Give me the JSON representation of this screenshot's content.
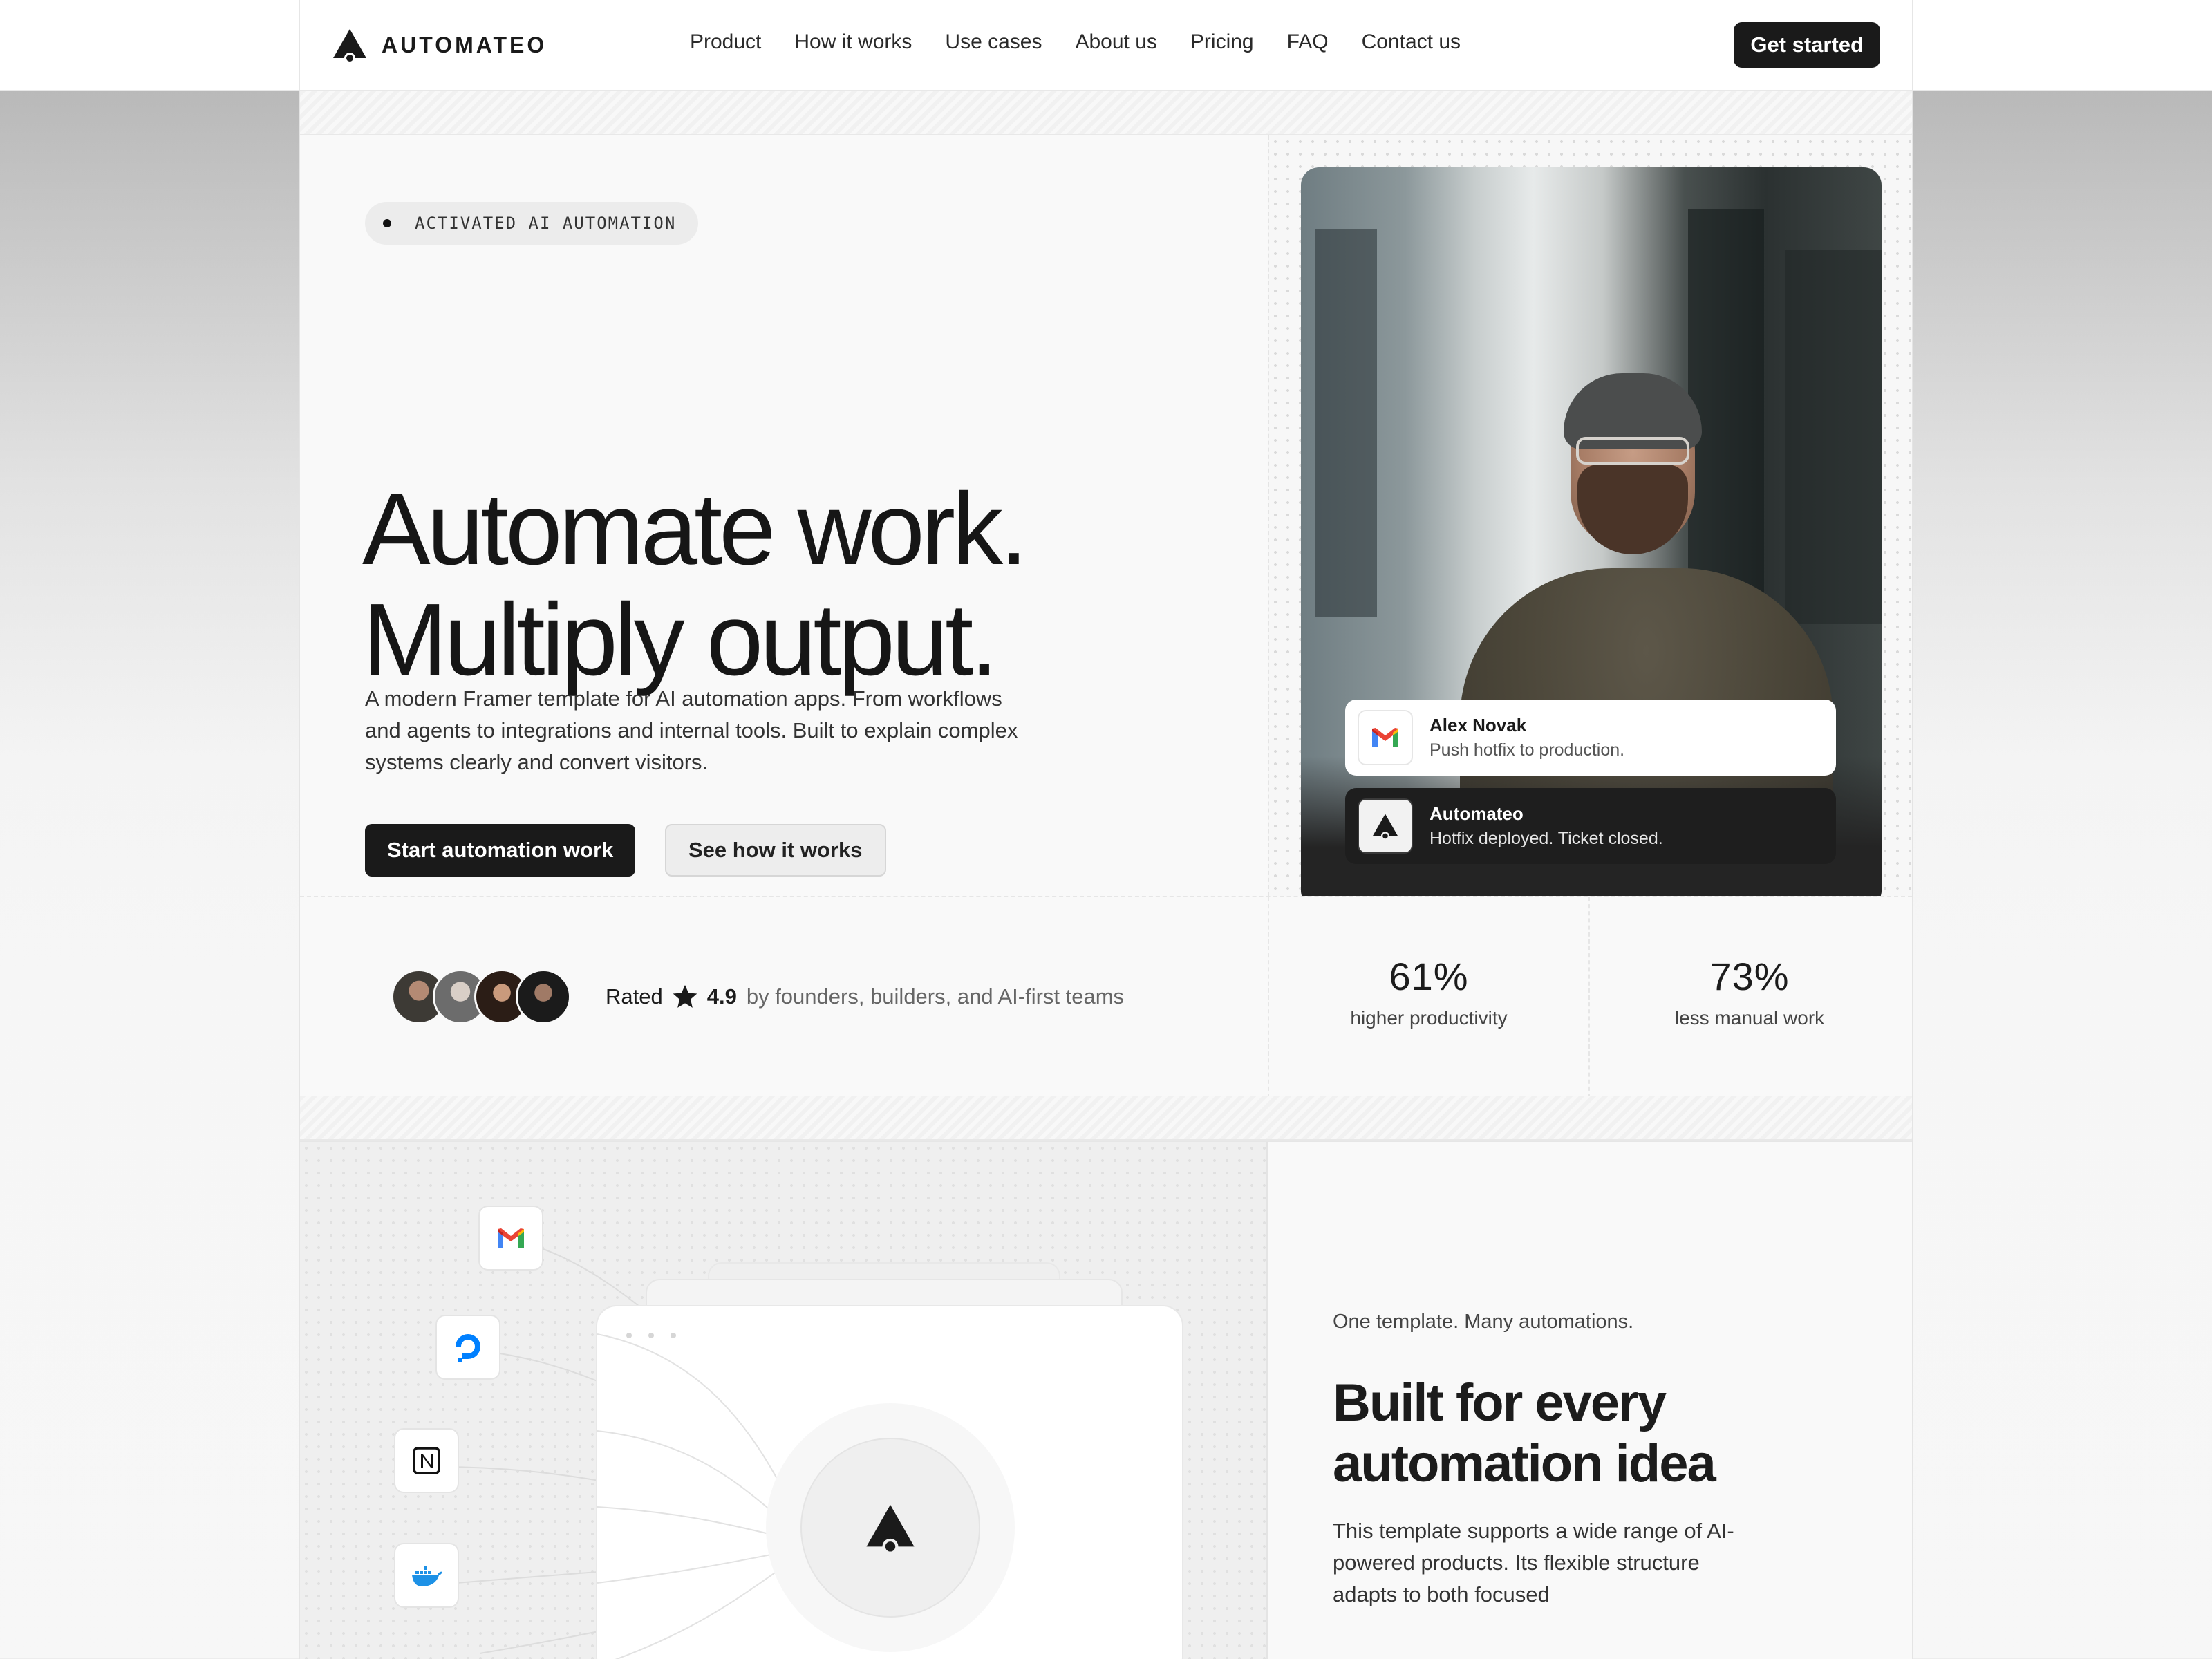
{
  "brand": {
    "name": "AUTOMATEO"
  },
  "nav": {
    "links": [
      "Product",
      "How it works",
      "Use cases",
      "About us",
      "Pricing",
      "FAQ",
      "Contact us"
    ],
    "cta": "Get started"
  },
  "hero": {
    "badge": "ACTIVATED AI AUTOMATION",
    "title_line1": "Automate work.",
    "title_line2": "Multiply output.",
    "subtitle": "A modern Framer template for AI automation apps. From workflows and agents to integrations and internal tools. Built to explain complex systems clearly and convert visitors.",
    "primary_cta": "Start automation work",
    "secondary_cta": "See how it works"
  },
  "notifications": [
    {
      "name": "Alex Novak",
      "message": "Push hotfix to production.",
      "icon": "gmail-icon"
    },
    {
      "name": "Automateo",
      "message": "Hotfix deployed. Ticket closed.",
      "icon": "automateo-logo-icon"
    }
  ],
  "social_proof": {
    "rated_label": "Rated",
    "rating": "4.9",
    "rated_tail": "by founders, builders, and AI-first teams"
  },
  "stats": [
    {
      "value": "61%",
      "label": "higher productivity"
    },
    {
      "value": "73%",
      "label": "less manual work"
    }
  ],
  "integrations": [
    "gmail-icon",
    "digitalocean-icon",
    "notion-icon",
    "docker-icon"
  ],
  "section2": {
    "eyebrow": "One template. Many automations.",
    "title_line1": "Built for every",
    "title_line2": "automation idea",
    "body": "This template supports a wide range of AI-powered products. Its flexible structure adapts to both focused"
  },
  "colors": {
    "accent": "#1a1a1a",
    "background": "#f9f9f9",
    "border": "#e6e6e6"
  }
}
